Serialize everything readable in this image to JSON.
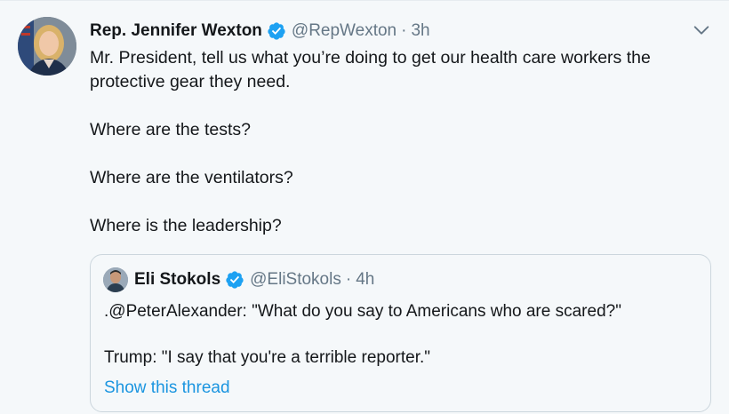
{
  "tweet": {
    "author_name": "Rep. Jennifer Wexton",
    "author_handle": "@RepWexton",
    "separator": "·",
    "time": "3h",
    "paragraphs": [
      "Mr. President, tell us what you’re doing to get our health care workers the protective gear they need.",
      "Where are the tests?",
      "Where are the ventilators?",
      "Where is the leadership?"
    ]
  },
  "quoted_tweet": {
    "author_name": "Eli Stokols",
    "author_handle": "@EliStokols",
    "separator": "·",
    "time": "4h",
    "paragraphs": [
      ".@PeterAlexander: \"What do you say to Americans who are scared?\"",
      "Trump: \"I say that you're a terrible reporter.\""
    ],
    "thread_link": "Show this thread"
  },
  "icons": {
    "verified": "verified-badge-icon",
    "menu": "chevron-down-icon"
  },
  "colors": {
    "background": "#f5f8fa",
    "link": "#1b95e0",
    "verified": "#1da1f2",
    "secondary_text": "#657786"
  }
}
